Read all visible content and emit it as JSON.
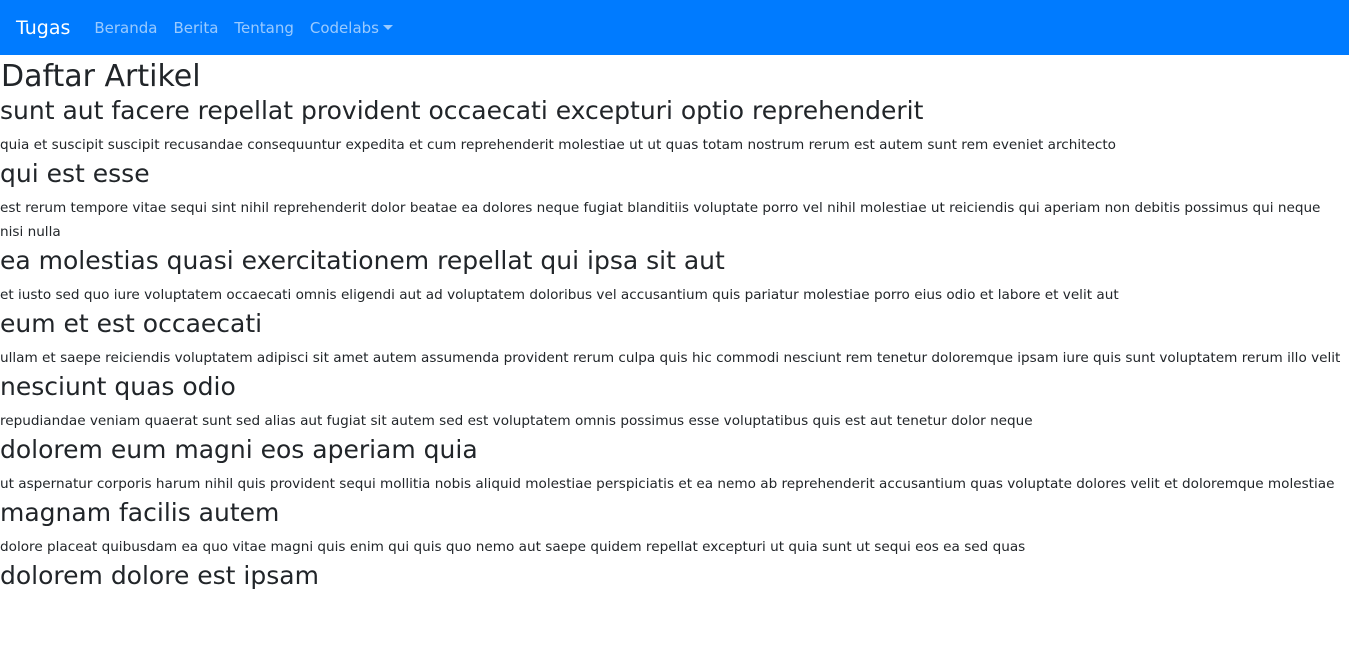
{
  "navbar": {
    "brand": "Tugas",
    "links": [
      "Beranda",
      "Berita",
      "Tentang",
      "Codelabs"
    ]
  },
  "page_title": "Daftar Artikel",
  "articles": [
    {
      "title": "sunt aut facere repellat provident occaecati excepturi optio reprehenderit",
      "body": "quia et suscipit suscipit recusandae consequuntur expedita et cum reprehenderit molestiae ut ut quas totam nostrum rerum est autem sunt rem eveniet architecto"
    },
    {
      "title": "qui est esse",
      "body": "est rerum tempore vitae sequi sint nihil reprehenderit dolor beatae ea dolores neque fugiat blanditiis voluptate porro vel nihil molestiae ut reiciendis qui aperiam non debitis possimus qui neque nisi nulla"
    },
    {
      "title": "ea molestias quasi exercitationem repellat qui ipsa sit aut",
      "body": "et iusto sed quo iure voluptatem occaecati omnis eligendi aut ad voluptatem doloribus vel accusantium quis pariatur molestiae porro eius odio et labore et velit aut"
    },
    {
      "title": "eum et est occaecati",
      "body": "ullam et saepe reiciendis voluptatem adipisci sit amet autem assumenda provident rerum culpa quis hic commodi nesciunt rem tenetur doloremque ipsam iure quis sunt voluptatem rerum illo velit"
    },
    {
      "title": "nesciunt quas odio",
      "body": "repudiandae veniam quaerat sunt sed alias aut fugiat sit autem sed est voluptatem omnis possimus esse voluptatibus quis est aut tenetur dolor neque"
    },
    {
      "title": "dolorem eum magni eos aperiam quia",
      "body": "ut aspernatur corporis harum nihil quis provident sequi mollitia nobis aliquid molestiae perspiciatis et ea nemo ab reprehenderit accusantium quas voluptate dolores velit et doloremque molestiae"
    },
    {
      "title": "magnam facilis autem",
      "body": "dolore placeat quibusdam ea quo vitae magni quis enim qui quis quo nemo aut saepe quidem repellat excepturi ut quia sunt ut sequi eos ea sed quas"
    },
    {
      "title": "dolorem dolore est ipsam",
      "body": ""
    }
  ]
}
